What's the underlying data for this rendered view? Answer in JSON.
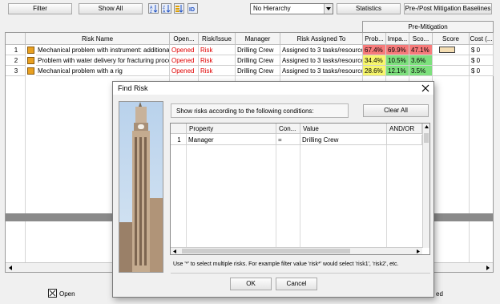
{
  "toolbar": {
    "filter_label": "Filter",
    "show_all_label": "Show All",
    "hierarchy_value": "No Hierarchy",
    "statistics_label": "Statistics",
    "baselines_label": "Pre-/Post Mitigation Baselines"
  },
  "grid": {
    "group_header": "Pre-Mitigation",
    "columns": [
      "Risk Name",
      "Open...",
      "Risk/Issue",
      "Manager",
      "Risk Assigned To",
      "Prob...",
      "Impa...",
      "Sco...",
      "Score",
      "Cost (..."
    ],
    "rows": [
      {
        "num": "1",
        "name": "Mechanical problem with instrument: additional t",
        "status": "Opened",
        "type": "Risk",
        "manager": "Drilling Crew",
        "assigned": "Assigned to 3 tasks/resource",
        "prob": "67.4%",
        "impact": "69.9%",
        "score": "47.1%",
        "cost": "$ 0"
      },
      {
        "num": "2",
        "name": "Problem with water delivery for fracturing proce",
        "status": "Opened",
        "type": "Risk",
        "manager": "Drilling Crew",
        "assigned": "Assigned to 3 tasks/resource",
        "prob": "34.4%",
        "impact": "10.5%",
        "score": "3.6%",
        "cost": "$ 0"
      },
      {
        "num": "3",
        "name": "Mechanical problem with a rig",
        "status": "Opened",
        "type": "Risk",
        "manager": "Drilling Crew",
        "assigned": "Assigned to 3 tasks/resource",
        "prob": "28.6%",
        "impact": "12.1%",
        "score": "3.5%",
        "cost": "$ 0"
      }
    ]
  },
  "dialog": {
    "title": "Find Risk",
    "conditions_label": "Show risks according to the following conditions:",
    "clear_all_label": "Clear All",
    "columns": [
      "Property",
      "Con...",
      "Value",
      "AND/OR"
    ],
    "rows": [
      {
        "num": "1",
        "property": "Manager",
        "condition": "=",
        "value": "Drilling Crew",
        "andor": ""
      }
    ],
    "hint": "Use '*' to select multiple risks. For example filter value 'risk*' would select 'risk1', 'risk2', etc.",
    "ok_label": "OK",
    "cancel_label": "Cancel"
  },
  "legend": {
    "open_label": "Open",
    "closed_label": "ed"
  }
}
